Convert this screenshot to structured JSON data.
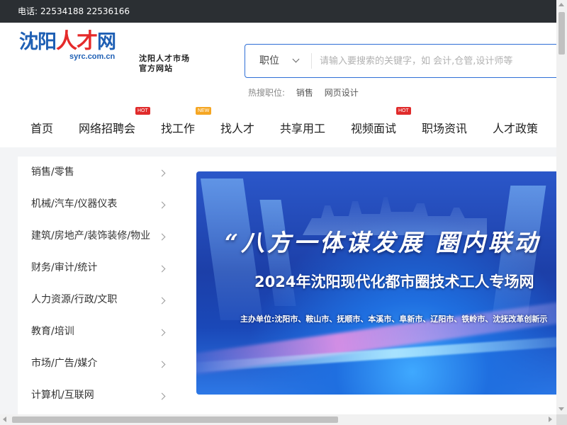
{
  "topbar": {
    "phone_label": "电话:",
    "phone_numbers": "22534188 22536166"
  },
  "logo": {
    "part1": "沈阳",
    "part2": "人才",
    "part3": "网",
    "domain": "syrc.com.cn",
    "tagline": "沈阳人才市场官方网站"
  },
  "search": {
    "category": "职位",
    "placeholder": "请输入要搜索的关键字，如 会计,仓管,设计师等",
    "value": ""
  },
  "hot_search": {
    "label": "热搜职位:",
    "keywords": [
      "销售",
      "网页设计"
    ]
  },
  "nav": {
    "items": [
      {
        "label": "首页"
      },
      {
        "label": "网络招聘会",
        "badge": "HOT"
      },
      {
        "label": "找工作",
        "badge": "NEW"
      },
      {
        "label": "找人才"
      },
      {
        "label": "共享用工"
      },
      {
        "label": "视频面试",
        "badge": "HOT"
      },
      {
        "label": "职场资讯"
      },
      {
        "label": "人才政策"
      }
    ]
  },
  "categories": [
    "销售/零售",
    "机械/汽车/仪器仪表",
    "建筑/房地产/装饰装修/物业",
    "财务/审计/统计",
    "人力资源/行政/文职",
    "教育/培训",
    "市场/广告/媒介",
    "计算机/互联网"
  ],
  "banner": {
    "title": "“八方一体谋发展  圈内联动",
    "subtitle": "2024年沈阳现代化都市圈技术工人专场网",
    "sponsor": "主办单位:沈阳市、鞍山市、抚顺市、本溪市、阜新市、辽阳市、铁岭市、沈抚改革创新示"
  },
  "colors": {
    "brand_blue": "#1e5fb4",
    "brand_red": "#e52a2a",
    "hot_badge": "#e02b2b",
    "new_badge": "#f5a623",
    "topbar_bg": "#2b2f33"
  }
}
